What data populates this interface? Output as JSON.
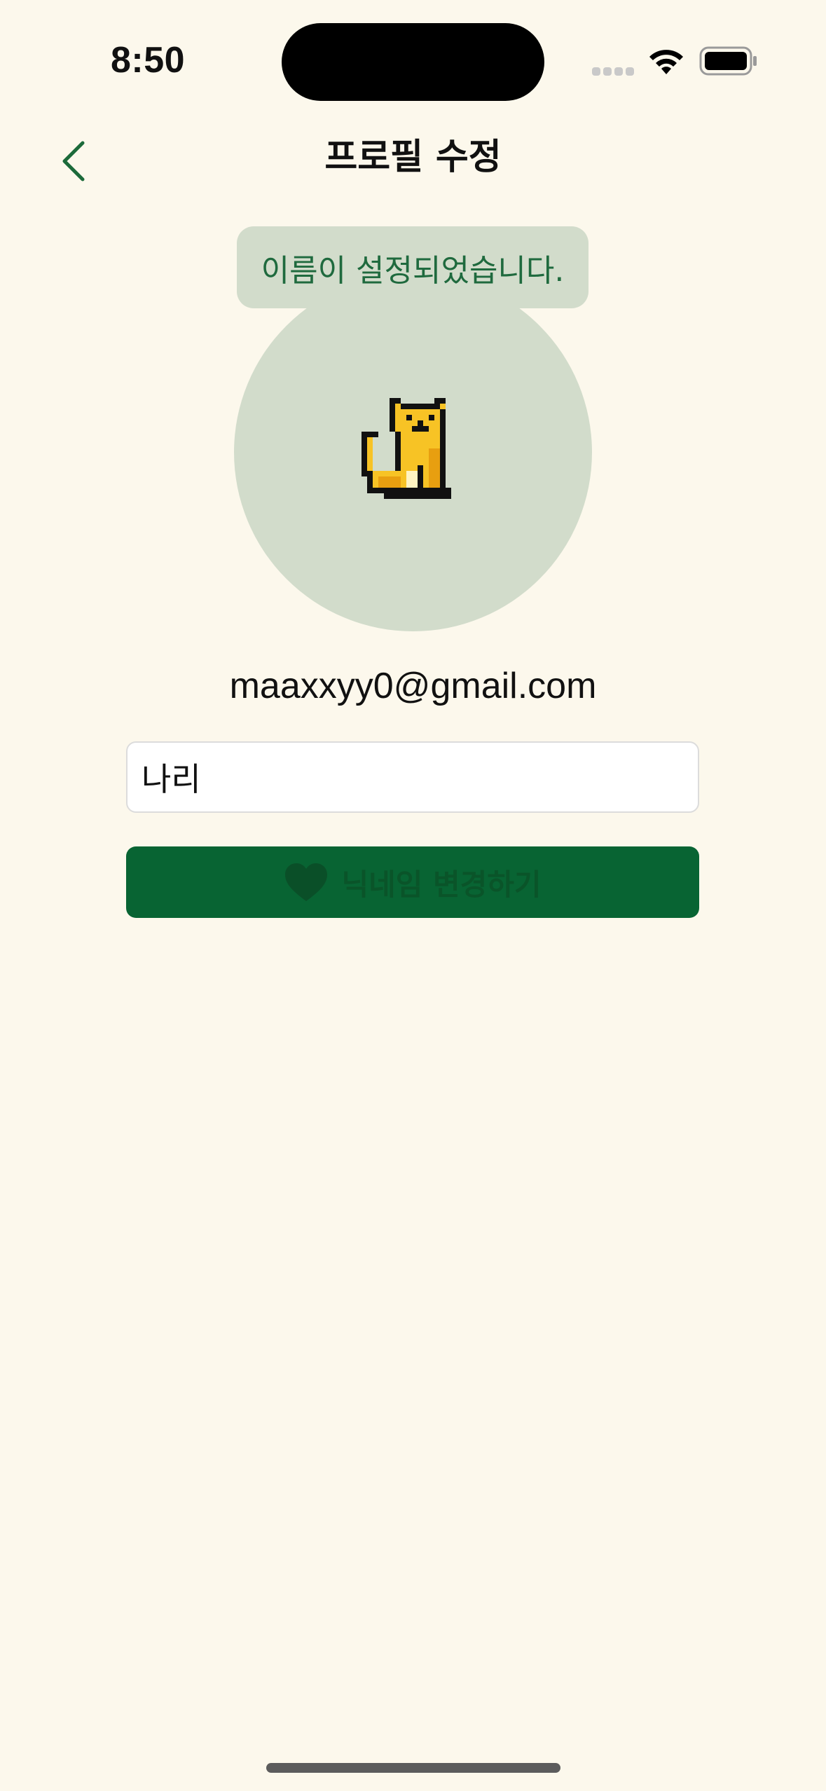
{
  "status_bar": {
    "time": "8:50",
    "icons": [
      "signal-icon",
      "wifi-icon",
      "battery-icon"
    ]
  },
  "header": {
    "title": "프로필 수정",
    "back_icon": "chevron-left-icon"
  },
  "toast": {
    "message": "이름이 설정되었습니다."
  },
  "profile": {
    "avatar_icon": "pixel-cat-icon",
    "email": "maaxxyy0@gmail.com"
  },
  "name_field": {
    "value": "나리",
    "placeholder": ""
  },
  "submit_button": {
    "icon": "heart-icon",
    "label": "닉네임 변경하기"
  },
  "colors": {
    "background": "#fcf8ec",
    "accent": "#086433",
    "toast_background": "#d2dccb",
    "toast_text": "#1f6a3e",
    "cat_fill": "#f7c325"
  }
}
